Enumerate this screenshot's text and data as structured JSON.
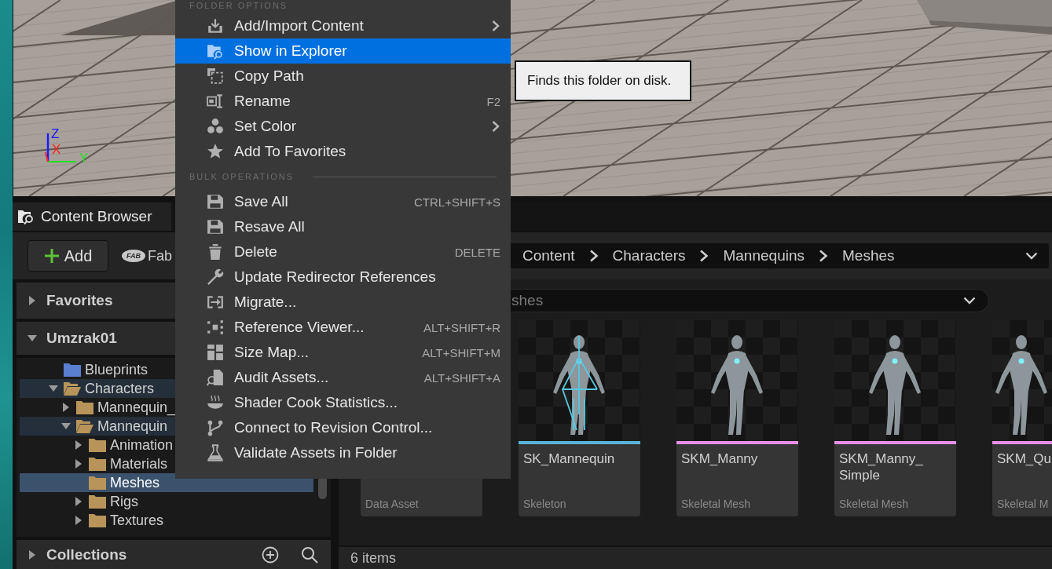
{
  "viewport": {
    "axis_labels": [
      "Z",
      "X",
      "Y"
    ]
  },
  "tab": {
    "title": "Content Browser"
  },
  "toolbar": {
    "add_label": "Add",
    "fab_logo": "FAB",
    "fab_label": "Fab"
  },
  "breadcrumb": [
    "Content",
    "Characters",
    "Mannequins",
    "Meshes"
  ],
  "sources": [
    {
      "title": "Favorites",
      "expanded": false
    },
    {
      "title": "Umzrak01",
      "expanded": true
    }
  ],
  "tree": [
    {
      "label": "Blueprints",
      "color": "#5b7fd0",
      "selected": false
    },
    {
      "label": "Characters",
      "color": "#b8945a",
      "expanded": true,
      "selected": false,
      "children": [
        {
          "label": "Mannequin_",
          "color": "#b8945a",
          "expanded": false,
          "selected": false
        },
        {
          "label": "Mannequin",
          "color": "#b8945a",
          "expanded": true,
          "selected": false,
          "children": [
            {
              "label": "Animation",
              "color": "#b8945a",
              "expanded": false,
              "selected": false
            },
            {
              "label": "Materials",
              "color": "#b8945a",
              "expanded": false,
              "selected": false
            },
            {
              "label": "Meshes",
              "color": "#b8945a",
              "selected": true
            },
            {
              "label": "Rigs",
              "color": "#b8945a",
              "expanded": false,
              "selected": false
            },
            {
              "label": "Textures",
              "color": "#b8945a",
              "expanded": false,
              "selected": false
            }
          ]
        }
      ]
    }
  ],
  "collections": {
    "title": "Collections",
    "expanded": false
  },
  "search": {
    "placeholder": "shes"
  },
  "assets": [
    {
      "type": "Data Asset"
    },
    {
      "name": "SK_Mannequin",
      "type": "Skeleton",
      "color": "#5ab4d6"
    },
    {
      "name": "SKM_Manny",
      "type": "Skeletal Mesh",
      "color": "#e88fe8"
    },
    {
      "name": "SKM_Manny_Simple",
      "type": "Skeletal Mesh",
      "color": "#e88fe8"
    },
    {
      "name": "SKM_Qu",
      "type": "Skeletal M",
      "color": "#e88fe8"
    }
  ],
  "status": "6 items",
  "context_menu": {
    "sections": [
      {
        "header": "FOLDER OPTIONS",
        "items": [
          {
            "label": "Add/Import Content",
            "submenu": true,
            "selected": false
          },
          {
            "label": "Show in Explorer",
            "selected": true
          },
          {
            "label": "Copy Path",
            "selected": false
          },
          {
            "label": "Rename",
            "shortcut": "F2",
            "selected": false
          },
          {
            "label": "Set Color",
            "submenu": true,
            "selected": false
          },
          {
            "label": "Add To Favorites",
            "selected": false
          }
        ]
      },
      {
        "header": "BULK OPERATIONS",
        "items": [
          {
            "label": "Save All",
            "shortcut": "CTRL+SHIFT+S",
            "selected": false
          },
          {
            "label": "Resave All",
            "selected": false
          },
          {
            "label": "Delete",
            "shortcut": "DELETE",
            "selected": false
          },
          {
            "label": "Update Redirector References",
            "selected": false
          },
          {
            "label": "Migrate...",
            "selected": false
          },
          {
            "label": "Reference Viewer...",
            "shortcut": "ALT+SHIFT+R",
            "selected": false
          },
          {
            "label": "Size Map...",
            "shortcut": "ALT+SHIFT+M",
            "selected": false
          },
          {
            "label": "Audit Assets...",
            "shortcut": "ALT+SHIFT+A",
            "selected": false
          },
          {
            "label": "Shader Cook Statistics...",
            "selected": false
          },
          {
            "label": "Connect to Revision Control...",
            "selected": false
          },
          {
            "label": "Validate Assets in Folder",
            "selected": false
          }
        ]
      }
    ]
  },
  "tooltip": "Finds this folder on disk."
}
